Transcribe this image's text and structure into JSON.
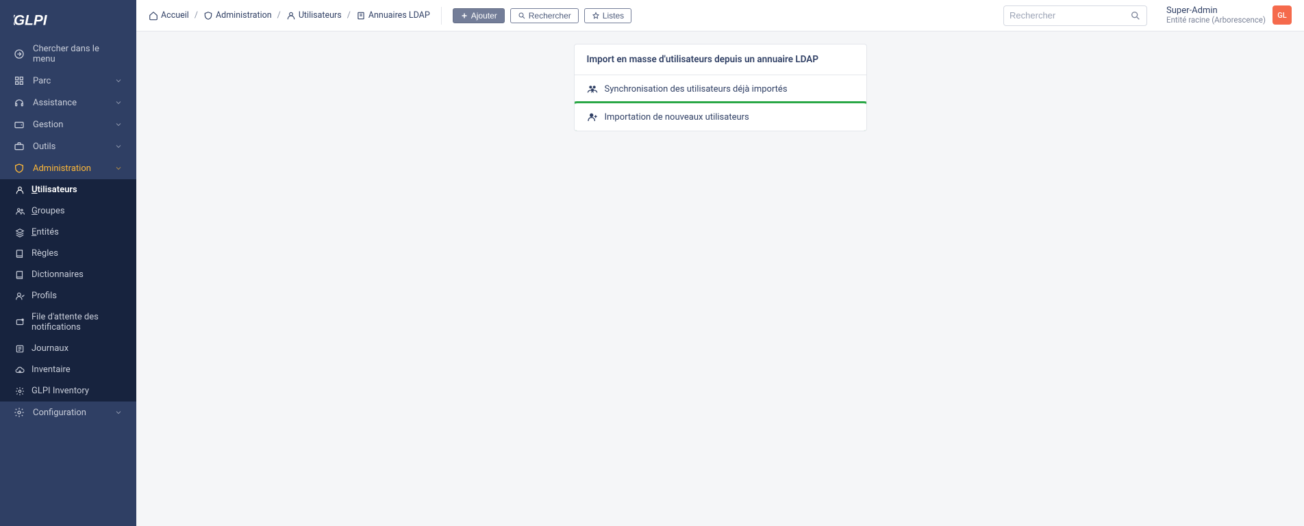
{
  "logo_text": "GLPI",
  "sidebar": {
    "search_menu": "Chercher dans le menu",
    "items": [
      {
        "label": "Parc"
      },
      {
        "label": "Assistance"
      },
      {
        "label": "Gestion"
      },
      {
        "label": "Outils"
      },
      {
        "label": "Administration"
      },
      {
        "label": "Configuration"
      }
    ],
    "admin_sub": [
      {
        "label": "Utilisateurs",
        "u": "U"
      },
      {
        "label": "Groupes",
        "u": "G"
      },
      {
        "label": "Entités",
        "u": "E"
      },
      {
        "label": "Règles"
      },
      {
        "label": "Dictionnaires"
      },
      {
        "label": "Profils"
      },
      {
        "label": "File d'attente des notifications"
      },
      {
        "label": "Journaux"
      },
      {
        "label": "Inventaire"
      },
      {
        "label": "GLPI Inventory"
      }
    ]
  },
  "breadcrumbs": [
    {
      "label": "Accueil"
    },
    {
      "label": "Administration"
    },
    {
      "label": "Utilisateurs"
    },
    {
      "label": "Annuaires LDAP"
    }
  ],
  "buttons": {
    "add": "Ajouter",
    "search": "Rechercher",
    "lists": "Listes"
  },
  "search": {
    "placeholder": "Rechercher"
  },
  "user": {
    "name": "Super-Admin",
    "entity": "Entité racine (Arborescence)",
    "initials": "GL"
  },
  "card": {
    "title": "Import en masse d'utilisateurs depuis un annuaire LDAP",
    "row1": "Synchronisation des utilisateurs déjà importés",
    "row2": "Importation de nouveaux utilisateurs"
  }
}
